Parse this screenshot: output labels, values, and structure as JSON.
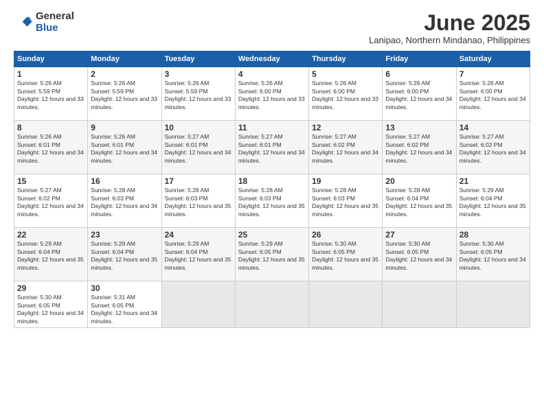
{
  "logo": {
    "general": "General",
    "blue": "Blue"
  },
  "title": "June 2025",
  "subtitle": "Lanipao, Northern Mindanao, Philippines",
  "headers": [
    "Sunday",
    "Monday",
    "Tuesday",
    "Wednesday",
    "Thursday",
    "Friday",
    "Saturday"
  ],
  "weeks": [
    [
      {
        "day": "1",
        "sunrise": "5:26 AM",
        "sunset": "5:59 PM",
        "daylight": "12 hours and 33 minutes."
      },
      {
        "day": "2",
        "sunrise": "5:26 AM",
        "sunset": "5:59 PM",
        "daylight": "12 hours and 33 minutes."
      },
      {
        "day": "3",
        "sunrise": "5:26 AM",
        "sunset": "5:59 PM",
        "daylight": "12 hours and 33 minutes."
      },
      {
        "day": "4",
        "sunrise": "5:26 AM",
        "sunset": "6:00 PM",
        "daylight": "12 hours and 33 minutes."
      },
      {
        "day": "5",
        "sunrise": "5:26 AM",
        "sunset": "6:00 PM",
        "daylight": "12 hours and 33 minutes."
      },
      {
        "day": "6",
        "sunrise": "5:26 AM",
        "sunset": "6:00 PM",
        "daylight": "12 hours and 34 minutes."
      },
      {
        "day": "7",
        "sunrise": "5:26 AM",
        "sunset": "6:00 PM",
        "daylight": "12 hours and 34 minutes."
      }
    ],
    [
      {
        "day": "8",
        "sunrise": "5:26 AM",
        "sunset": "6:01 PM",
        "daylight": "12 hours and 34 minutes."
      },
      {
        "day": "9",
        "sunrise": "5:26 AM",
        "sunset": "6:01 PM",
        "daylight": "12 hours and 34 minutes."
      },
      {
        "day": "10",
        "sunrise": "5:27 AM",
        "sunset": "6:01 PM",
        "daylight": "12 hours and 34 minutes."
      },
      {
        "day": "11",
        "sunrise": "5:27 AM",
        "sunset": "6:01 PM",
        "daylight": "12 hours and 34 minutes."
      },
      {
        "day": "12",
        "sunrise": "5:27 AM",
        "sunset": "6:02 PM",
        "daylight": "12 hours and 34 minutes."
      },
      {
        "day": "13",
        "sunrise": "5:27 AM",
        "sunset": "6:02 PM",
        "daylight": "12 hours and 34 minutes."
      },
      {
        "day": "14",
        "sunrise": "5:27 AM",
        "sunset": "6:02 PM",
        "daylight": "12 hours and 34 minutes."
      }
    ],
    [
      {
        "day": "15",
        "sunrise": "5:27 AM",
        "sunset": "6:02 PM",
        "daylight": "12 hours and 34 minutes."
      },
      {
        "day": "16",
        "sunrise": "5:28 AM",
        "sunset": "6:03 PM",
        "daylight": "12 hours and 34 minutes."
      },
      {
        "day": "17",
        "sunrise": "5:28 AM",
        "sunset": "6:03 PM",
        "daylight": "12 hours and 35 minutes."
      },
      {
        "day": "18",
        "sunrise": "5:28 AM",
        "sunset": "6:03 PM",
        "daylight": "12 hours and 35 minutes."
      },
      {
        "day": "19",
        "sunrise": "5:28 AM",
        "sunset": "6:03 PM",
        "daylight": "12 hours and 35 minutes."
      },
      {
        "day": "20",
        "sunrise": "5:28 AM",
        "sunset": "6:04 PM",
        "daylight": "12 hours and 35 minutes."
      },
      {
        "day": "21",
        "sunrise": "5:29 AM",
        "sunset": "6:04 PM",
        "daylight": "12 hours and 35 minutes."
      }
    ],
    [
      {
        "day": "22",
        "sunrise": "5:29 AM",
        "sunset": "6:04 PM",
        "daylight": "12 hours and 35 minutes."
      },
      {
        "day": "23",
        "sunrise": "5:29 AM",
        "sunset": "6:04 PM",
        "daylight": "12 hours and 35 minutes."
      },
      {
        "day": "24",
        "sunrise": "5:29 AM",
        "sunset": "6:04 PM",
        "daylight": "12 hours and 35 minutes."
      },
      {
        "day": "25",
        "sunrise": "5:29 AM",
        "sunset": "6:05 PM",
        "daylight": "12 hours and 35 minutes."
      },
      {
        "day": "26",
        "sunrise": "5:30 AM",
        "sunset": "6:05 PM",
        "daylight": "12 hours and 35 minutes."
      },
      {
        "day": "27",
        "sunrise": "5:30 AM",
        "sunset": "6:05 PM",
        "daylight": "12 hours and 34 minutes."
      },
      {
        "day": "28",
        "sunrise": "5:30 AM",
        "sunset": "6:05 PM",
        "daylight": "12 hours and 34 minutes."
      }
    ],
    [
      {
        "day": "29",
        "sunrise": "5:30 AM",
        "sunset": "6:05 PM",
        "daylight": "12 hours and 34 minutes."
      },
      {
        "day": "30",
        "sunrise": "5:31 AM",
        "sunset": "6:05 PM",
        "daylight": "12 hours and 34 minutes."
      },
      null,
      null,
      null,
      null,
      null
    ]
  ]
}
